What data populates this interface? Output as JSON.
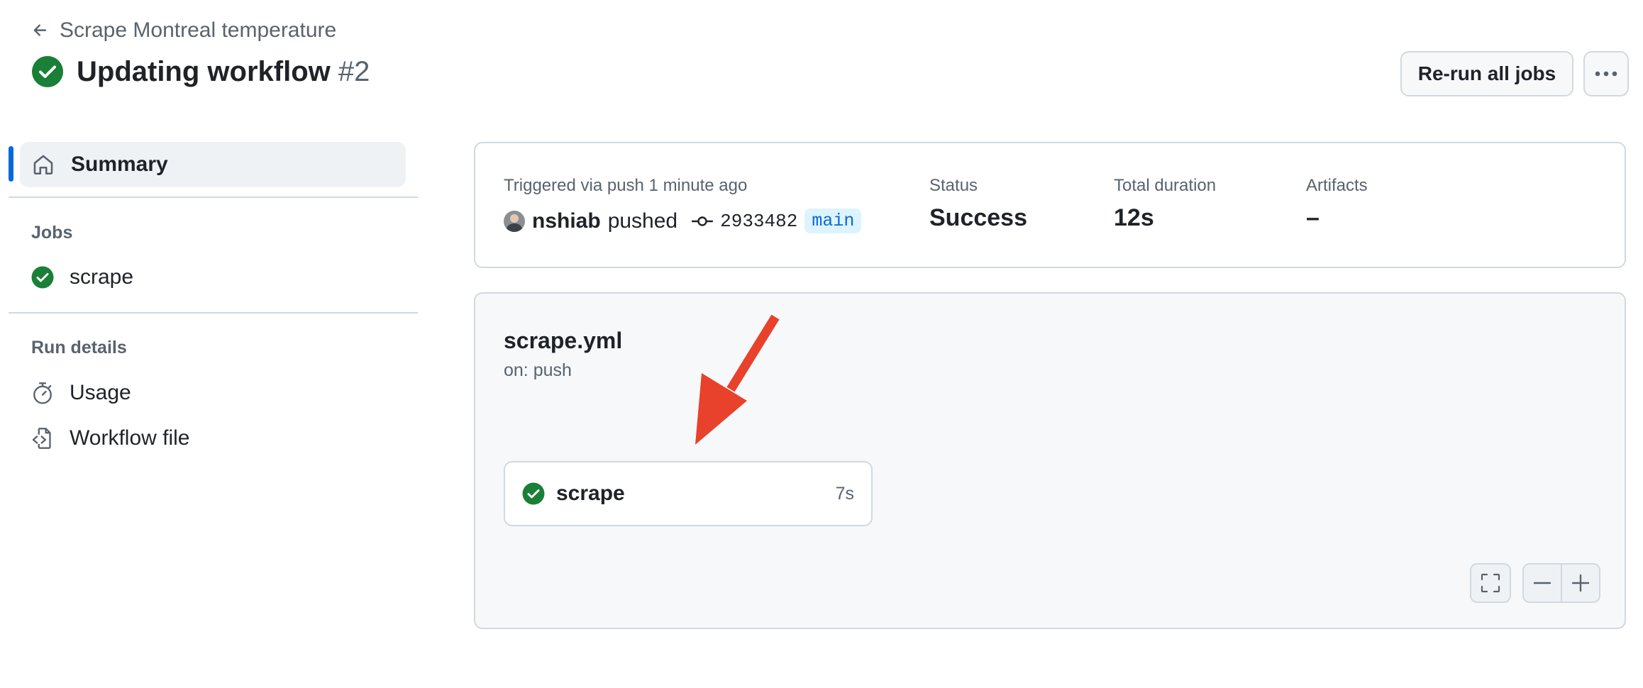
{
  "header": {
    "back_label": "Scrape Montreal temperature",
    "title": "Updating workflow",
    "run_number": "#2",
    "rerun_label": "Re-run all jobs"
  },
  "sidebar": {
    "summary_label": "Summary",
    "jobs_heading": "Jobs",
    "jobs": [
      {
        "label": "scrape"
      }
    ],
    "run_details_heading": "Run details",
    "run_details": [
      {
        "label": "Usage"
      },
      {
        "label": "Workflow file"
      }
    ]
  },
  "summary": {
    "trigger_text": "Triggered via push 1 minute ago",
    "actor": "nshiab",
    "action": "pushed",
    "commit": "2933482",
    "branch": "main",
    "status_label": "Status",
    "status_value": "Success",
    "duration_label": "Total duration",
    "duration_value": "12s",
    "artifacts_label": "Artifacts",
    "artifacts_value": "–"
  },
  "graph": {
    "workflow_file": "scrape.yml",
    "trigger": "on: push",
    "job_name": "scrape",
    "job_duration": "7s"
  },
  "colors": {
    "success": "#1a7f37",
    "accent": "#0969da",
    "annotation_arrow": "#e8412c"
  }
}
